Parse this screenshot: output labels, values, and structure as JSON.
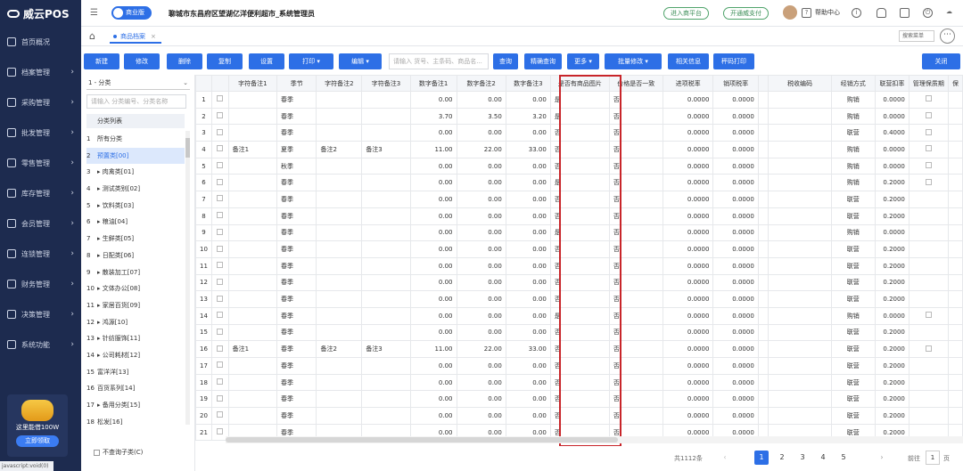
{
  "app": {
    "name": "威云POS"
  },
  "sidebar": {
    "items": [
      {
        "label": "首页概况"
      },
      {
        "label": "档案管理"
      },
      {
        "label": "采购管理"
      },
      {
        "label": "批发管理"
      },
      {
        "label": "零售管理"
      },
      {
        "label": "库存管理"
      },
      {
        "label": "会员管理"
      },
      {
        "label": "连锁管理"
      },
      {
        "label": "财务管理"
      },
      {
        "label": "决策管理"
      },
      {
        "label": "系统功能"
      }
    ],
    "promo_text": "这里能借100W",
    "promo_button": "立即领取"
  },
  "status_bar": "javascript:void(0)",
  "topbar": {
    "edition": "商业版",
    "store": "聊城市东昌府区望湖亿洋便利超市_系统管理员",
    "partner": "进入商平台",
    "pay": "开通威支付",
    "help": "帮助中心"
  },
  "tabs": {
    "active": "商品档案",
    "menu_search": "搜索菜单"
  },
  "toolbar": {
    "new": "新建",
    "edit": "修改",
    "delete": "删除",
    "copy": "复制",
    "settings": "设置",
    "print": "打印",
    "compile": "编辑",
    "search_placeholder": "请输入 货号、主条码、商品名...",
    "query": "查询",
    "precise": "精确查询",
    "more": "更多",
    "batch": "批量修改",
    "related": "相关信息",
    "barcode_print": "秤码打印",
    "close": "关闭"
  },
  "category": {
    "selector": "1 - 分类",
    "search_placeholder": "请输入 分类编号、分类名称",
    "list_header": "分类列表",
    "items": [
      {
        "num": "1",
        "label": "所有分类"
      },
      {
        "num": "2",
        "label": "预置类[00]"
      },
      {
        "num": "3",
        "label": "▸ 肉禽类[01]"
      },
      {
        "num": "4",
        "label": "▸ 测试类别[02]"
      },
      {
        "num": "5",
        "label": "▸ 饮料类[03]"
      },
      {
        "num": "6",
        "label": "▸ 粮油[04]"
      },
      {
        "num": "7",
        "label": "▸ 生鲜类[05]"
      },
      {
        "num": "8",
        "label": "▸ 日配类[06]"
      },
      {
        "num": "9",
        "label": "▸ 散装加工[07]"
      },
      {
        "num": "10",
        "label": "▸ 文体办公[08]"
      },
      {
        "num": "11",
        "label": "▸ 家居百货[09]"
      },
      {
        "num": "12",
        "label": "▸ 鸿源[10]"
      },
      {
        "num": "13",
        "label": "▸ 针纺服饰[11]"
      },
      {
        "num": "14",
        "label": "▸ 公司耗材[12]"
      },
      {
        "num": "15",
        "label": "富洋洋[13]"
      },
      {
        "num": "16",
        "label": "百货系列[14]"
      },
      {
        "num": "17",
        "label": "▸ 备用分类[15]"
      },
      {
        "num": "18",
        "label": "松发[16]"
      }
    ],
    "footer": "不查询子类(C)"
  },
  "table": {
    "headers": [
      "",
      "",
      "字符备注1",
      "季节",
      "字符备注2",
      "字符备注3",
      "数字备注1",
      "数字备注2",
      "数字备注3",
      "是否有商品图片",
      "价格是否一致",
      "进项税率",
      "销项税率",
      "",
      "税收编码",
      "经销方式",
      "联营扣率",
      "管理保质期",
      "保"
    ],
    "rows": [
      [
        "1",
        "",
        "",
        "春季",
        "",
        "",
        "0.00",
        "0.00",
        "0.00",
        "是",
        "否",
        "0.0000",
        "0.0000",
        "",
        "",
        "购销",
        "0.0000",
        "◻"
      ],
      [
        "2",
        "",
        "",
        "春季",
        "",
        "",
        "3.70",
        "3.50",
        "3.20",
        "是",
        "否",
        "0.0000",
        "0.0000",
        "",
        "",
        "购销",
        "0.0000",
        "◻"
      ],
      [
        "3",
        "",
        "",
        "春季",
        "",
        "",
        "0.00",
        "0.00",
        "0.00",
        "否",
        "否",
        "0.0000",
        "0.0000",
        "",
        "",
        "联营",
        "0.4000",
        "◻"
      ],
      [
        "4",
        "",
        "备注1",
        "夏季",
        "备注2",
        "备注3",
        "11.00",
        "22.00",
        "33.00",
        "否",
        "否",
        "0.0000",
        "0.0000",
        "",
        "",
        "购销",
        "0.0000",
        "◻"
      ],
      [
        "5",
        "",
        "",
        "秋季",
        "",
        "",
        "0.00",
        "0.00",
        "0.00",
        "否",
        "否",
        "0.0000",
        "0.0000",
        "",
        "",
        "购销",
        "0.0000",
        "◻"
      ],
      [
        "6",
        "",
        "",
        "春季",
        "",
        "",
        "0.00",
        "0.00",
        "0.00",
        "是",
        "否",
        "0.0000",
        "0.0000",
        "",
        "",
        "购销",
        "0.2000",
        "◻"
      ],
      [
        "7",
        "",
        "",
        "春季",
        "",
        "",
        "0.00",
        "0.00",
        "0.00",
        "否",
        "否",
        "0.0000",
        "0.0000",
        "",
        "",
        "联营",
        "0.2000",
        ""
      ],
      [
        "8",
        "",
        "",
        "春季",
        "",
        "",
        "0.00",
        "0.00",
        "0.00",
        "否",
        "否",
        "0.0000",
        "0.0000",
        "",
        "",
        "联营",
        "0.2000",
        ""
      ],
      [
        "9",
        "",
        "",
        "春季",
        "",
        "",
        "0.00",
        "0.00",
        "0.00",
        "是",
        "否",
        "0.0000",
        "0.0000",
        "",
        "",
        "购销",
        "0.0000",
        ""
      ],
      [
        "10",
        "",
        "",
        "春季",
        "",
        "",
        "0.00",
        "0.00",
        "0.00",
        "否",
        "否",
        "0.0000",
        "0.0000",
        "",
        "",
        "联营",
        "0.2000",
        ""
      ],
      [
        "11",
        "",
        "",
        "春季",
        "",
        "",
        "0.00",
        "0.00",
        "0.00",
        "否",
        "否",
        "0.0000",
        "0.0000",
        "",
        "",
        "联营",
        "0.2000",
        ""
      ],
      [
        "12",
        "",
        "",
        "春季",
        "",
        "",
        "0.00",
        "0.00",
        "0.00",
        "否",
        "否",
        "0.0000",
        "0.0000",
        "",
        "",
        "联营",
        "0.2000",
        ""
      ],
      [
        "13",
        "",
        "",
        "春季",
        "",
        "",
        "0.00",
        "0.00",
        "0.00",
        "否",
        "否",
        "0.0000",
        "0.0000",
        "",
        "",
        "联营",
        "0.2000",
        ""
      ],
      [
        "14",
        "",
        "",
        "春季",
        "",
        "",
        "0.00",
        "0.00",
        "0.00",
        "是",
        "否",
        "0.0000",
        "0.0000",
        "",
        "",
        "购销",
        "0.0000",
        "◻"
      ],
      [
        "15",
        "",
        "",
        "春季",
        "",
        "",
        "0.00",
        "0.00",
        "0.00",
        "否",
        "否",
        "0.0000",
        "0.0000",
        "",
        "",
        "联营",
        "0.2000",
        ""
      ],
      [
        "16",
        "",
        "备注1",
        "春季",
        "备注2",
        "备注3",
        "11.00",
        "22.00",
        "33.00",
        "否",
        "否",
        "0.0000",
        "0.0000",
        "",
        "",
        "联营",
        "0.2000",
        "◻"
      ],
      [
        "17",
        "",
        "",
        "春季",
        "",
        "",
        "0.00",
        "0.00",
        "0.00",
        "否",
        "否",
        "0.0000",
        "0.0000",
        "",
        "",
        "联营",
        "0.2000",
        ""
      ],
      [
        "18",
        "",
        "",
        "春季",
        "",
        "",
        "0.00",
        "0.00",
        "0.00",
        "否",
        "否",
        "0.0000",
        "0.0000",
        "",
        "",
        "联营",
        "0.2000",
        ""
      ],
      [
        "19",
        "",
        "",
        "春季",
        "",
        "",
        "0.00",
        "0.00",
        "0.00",
        "否",
        "否",
        "0.0000",
        "0.0000",
        "",
        "",
        "联营",
        "0.2000",
        ""
      ],
      [
        "20",
        "",
        "",
        "春季",
        "",
        "",
        "0.00",
        "0.00",
        "0.00",
        "否",
        "否",
        "0.0000",
        "0.0000",
        "",
        "",
        "联营",
        "0.2000",
        ""
      ],
      [
        "21",
        "",
        "",
        "春季",
        "",
        "",
        "0.00",
        "0.00",
        "0.00",
        "否",
        "否",
        "0.0000",
        "0.0000",
        "",
        "",
        "联营",
        "0.2000",
        ""
      ]
    ]
  },
  "pager": {
    "total": "共1112条",
    "pages": [
      "1",
      "2",
      "3",
      "4",
      "5"
    ],
    "current": "1",
    "goto_label": "前往",
    "goto_value": "1",
    "goto_unit": "页"
  },
  "colors": {
    "primary": "#2d6fe6",
    "sidebar": "#1d2b4f",
    "highlight": "#c8252a"
  }
}
